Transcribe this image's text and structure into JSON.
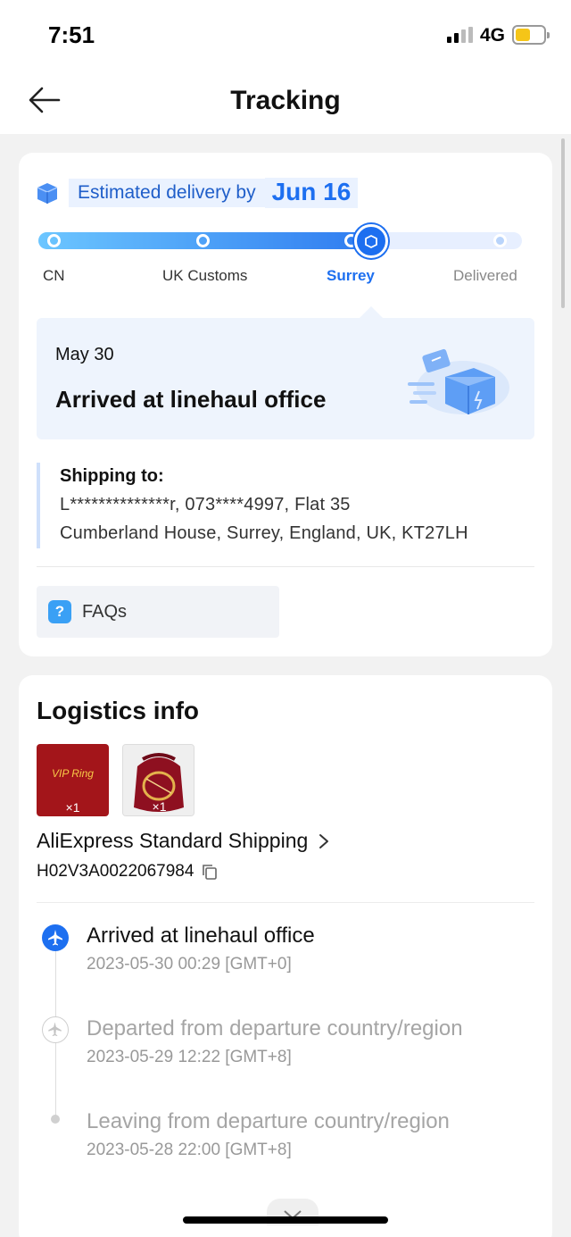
{
  "status_bar": {
    "time": "7:51",
    "network": "4G"
  },
  "header": {
    "title": "Tracking",
    "back_icon": "arrow-left-icon"
  },
  "delivery": {
    "estimate_label": "Estimated delivery by",
    "estimate_date": "Jun 16",
    "progress_stops": [
      "CN",
      "UK Customs",
      "Surrey",
      "Delivered"
    ],
    "current_stop": "Surrey",
    "latest_date": "May 30",
    "latest_status": "Arrived at linehaul office"
  },
  "shipping": {
    "heading": "Shipping to:",
    "line1": "L**************r,  073****4997,  Flat 35",
    "line2": "Cumberland House,  Surrey,  England,  UK,  KT27LH"
  },
  "faq": {
    "label": "FAQs",
    "icon": "question-icon"
  },
  "logistics": {
    "title": "Logistics info",
    "items": [
      {
        "label": "VIP Ring",
        "qty": "×1"
      },
      {
        "qty": "×1"
      }
    ],
    "carrier": "AliExpress Standard Shipping",
    "tracking_number": "H02V3A0022067984",
    "events": [
      {
        "title": "Arrived at linehaul office",
        "time": "2023-05-30 00:29 [GMT+0]",
        "active": true
      },
      {
        "title": "Departed from departure country/region",
        "time": "2023-05-29 12:22 [GMT+8]",
        "active": false
      },
      {
        "title": "Leaving from departure country/region",
        "time": "2023-05-28 22:00 [GMT+8]",
        "active": false
      }
    ]
  },
  "colors": {
    "accent": "#1d6ff0",
    "light_accent": "#eef4fd"
  }
}
